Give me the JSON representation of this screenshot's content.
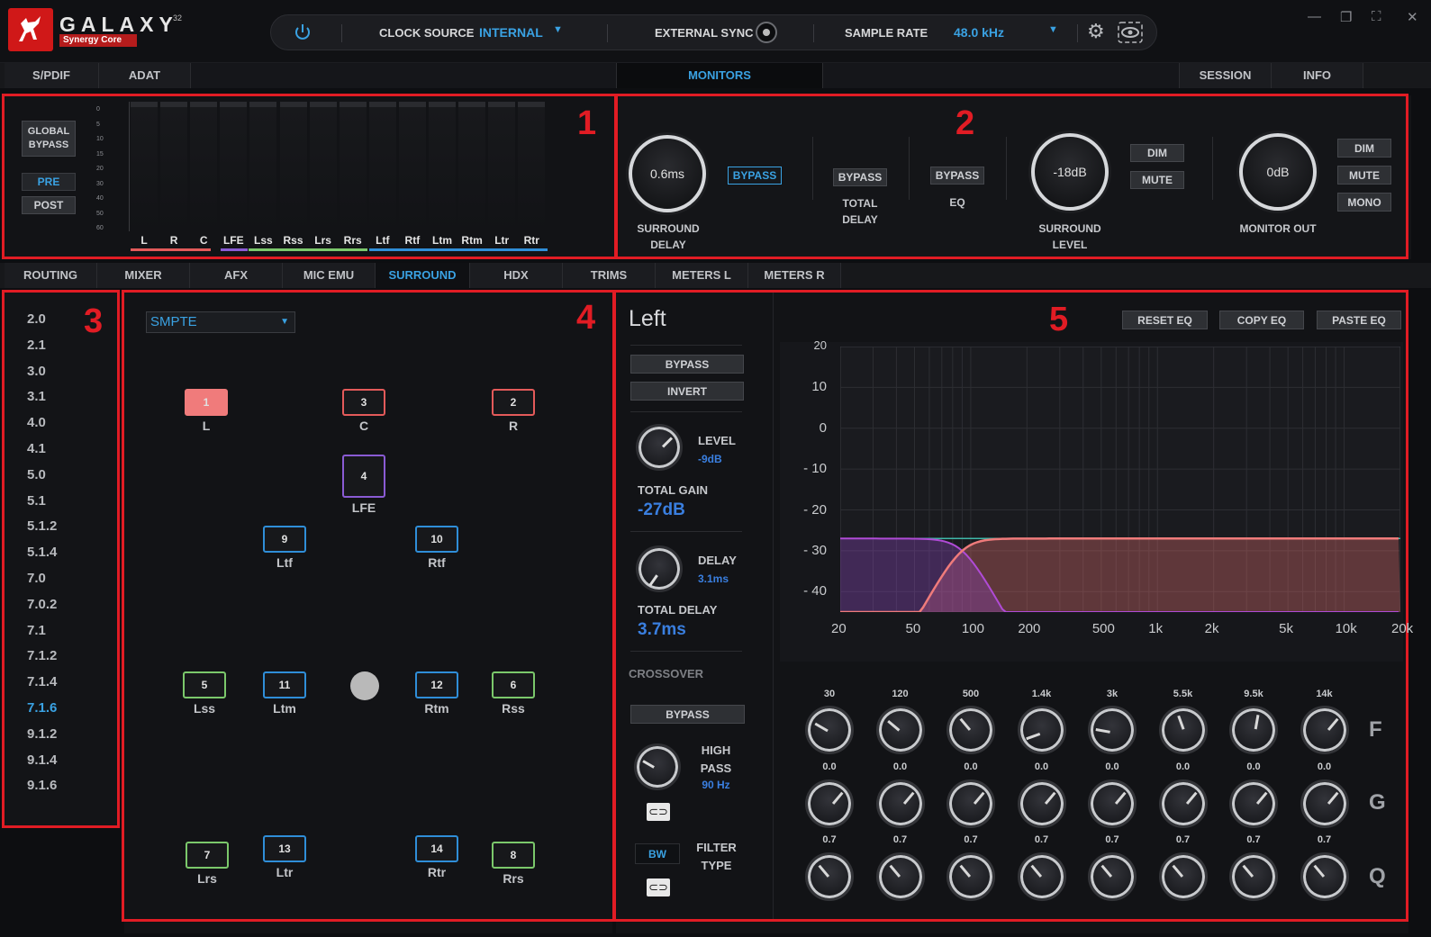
{
  "app": {
    "title": "GALAXY",
    "title_sup": "32",
    "subtitle": "Synergy Core"
  },
  "clock": {
    "source_label": "CLOCK SOURCE",
    "source_value": "INTERNAL",
    "ext_sync_label": "EXTERNAL SYNC",
    "rate_label": "SAMPLE RATE",
    "rate_value": "48.0 kHz"
  },
  "top_tabs": [
    "S/PDIF",
    "ADAT",
    "MONITORS",
    "SESSION",
    "INFO"
  ],
  "section1": {
    "global_bypass": "GLOBAL BYPASS",
    "pre": "PRE",
    "post": "POST",
    "scale": [
      "0",
      "5",
      "10",
      "15",
      "20",
      "30",
      "40",
      "50",
      "60"
    ],
    "meters": [
      "L",
      "R",
      "C",
      "LFE",
      "Lss",
      "Rss",
      "Lrs",
      "Rrs",
      "Ltf",
      "Rtf",
      "Ltm",
      "Rtm",
      "Ltr",
      "Rtr"
    ]
  },
  "section2": {
    "surround_delay_value": "0.6ms",
    "surround_delay_label": "SURROUND DELAY",
    "bypass1": "BYPASS",
    "bypass2": "BYPASS",
    "total_delay_label": "TOTAL DELAY",
    "bypass3": "BYPASS",
    "eq_label": "EQ",
    "surround_level_value": "-18dB",
    "surround_level_label": "SURROUND LEVEL",
    "dim1": "DIM",
    "mute1": "MUTE",
    "monitor_out_value": "0dB",
    "monitor_out_label": "MONITOR OUT",
    "dim2": "DIM",
    "mute2": "MUTE",
    "mono": "MONO"
  },
  "mid_tabs": [
    "ROUTING",
    "MIXER",
    "AFX",
    "MIC EMU",
    "SURROUND",
    "HDX",
    "TRIMS",
    "METERS L",
    "METERS R"
  ],
  "formats": [
    "2.0",
    "2.1",
    "3.0",
    "3.1",
    "4.0",
    "4.1",
    "5.0",
    "5.1",
    "5.1.2",
    "5.1.4",
    "7.0",
    "7.0.2",
    "7.1",
    "7.1.2",
    "7.1.4",
    "7.1.6",
    "9.1.2",
    "9.1.4",
    "9.1.6"
  ],
  "active_format": "7.1.6",
  "layout_select": "SMPTE",
  "speakers": [
    {
      "n": "1",
      "l": "L",
      "c": "red fill"
    },
    {
      "n": "3",
      "l": "C",
      "c": "red"
    },
    {
      "n": "2",
      "l": "R",
      "c": "red"
    },
    {
      "n": "4",
      "l": "LFE",
      "c": "pur"
    },
    {
      "n": "9",
      "l": "Ltf",
      "c": "blu"
    },
    {
      "n": "10",
      "l": "Rtf",
      "c": "blu"
    },
    {
      "n": "5",
      "l": "Lss",
      "c": "grn"
    },
    {
      "n": "11",
      "l": "Ltm",
      "c": "blu"
    },
    {
      "n": "12",
      "l": "Rtm",
      "c": "blu"
    },
    {
      "n": "6",
      "l": "Rss",
      "c": "grn"
    },
    {
      "n": "7",
      "l": "Lrs",
      "c": "grn"
    },
    {
      "n": "13",
      "l": "Ltr",
      "c": "blu"
    },
    {
      "n": "14",
      "l": "Rtr",
      "c": "blu"
    },
    {
      "n": "8",
      "l": "Rrs",
      "c": "grn"
    }
  ],
  "channel": {
    "name": "Left",
    "bypass": "BYPASS",
    "invert": "INVERT",
    "level_label": "LEVEL",
    "level_value": "-9dB",
    "total_gain_label": "TOTAL GAIN",
    "total_gain_value": "-27dB",
    "delay_label": "DELAY",
    "delay_value": "3.1ms",
    "total_delay_label": "TOTAL DELAY",
    "total_delay_value": "3.7ms",
    "crossover_label": "CROSSOVER",
    "xover_bypass": "BYPASS",
    "high_pass_label": "HIGH PASS",
    "high_pass_value": "90 Hz",
    "filter_type_value": "BW",
    "filter_type_label": "FILTER TYPE"
  },
  "eq": {
    "reset": "RESET EQ",
    "copy": "COPY EQ",
    "paste": "PASTE EQ",
    "y_ticks": [
      "20",
      "10",
      "0",
      "- 10",
      "- 20",
      "- 30",
      "- 40"
    ],
    "x_ticks": [
      "20",
      "50",
      "100",
      "200",
      "500",
      "1k",
      "2k",
      "5k",
      "10k",
      "20k"
    ],
    "bands_f": [
      "30",
      "120",
      "500",
      "1.4k",
      "3k",
      "5.5k",
      "9.5k",
      "14k"
    ],
    "bands_g": [
      "0.0",
      "0.0",
      "0.0",
      "0.0",
      "0.0",
      "0.0",
      "0.0",
      "0.0"
    ],
    "bands_q": [
      "0.7",
      "0.7",
      "0.7",
      "0.7",
      "0.7",
      "0.7",
      "0.7",
      "0.7"
    ],
    "row_f": "F",
    "row_g": "G",
    "row_q": "Q"
  },
  "callouts": [
    "1",
    "2",
    "3",
    "4",
    "5"
  ]
}
